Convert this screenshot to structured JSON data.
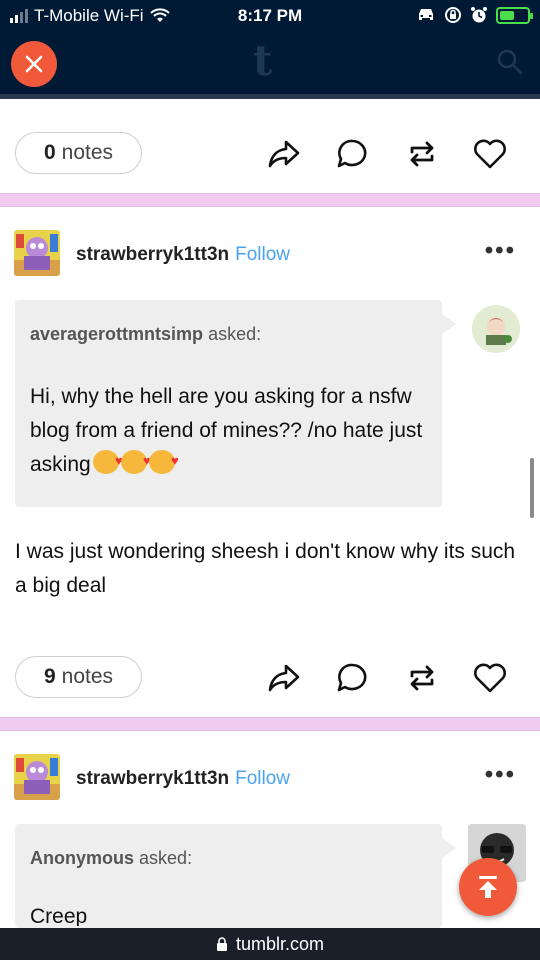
{
  "status_bar": {
    "carrier": "T-Mobile Wi-Fi",
    "time": "8:17 PM",
    "battery_percent": 45
  },
  "nav": {
    "logo": "t",
    "accent": "#f05a3a",
    "background": "#001935"
  },
  "posts": [
    {
      "notes_count": "0",
      "notes_label": "notes"
    },
    {
      "blog_name": "strawberryk1tt3n",
      "follow_label": "Follow",
      "more_label": "•••",
      "asker": "averagerottmntsimp",
      "asked_label": "asked:",
      "question": "Hi, why the hell are you asking for a nsfw blog from a friend of mines?? /no hate just asking",
      "answer": "I was just wondering sheesh i don't know why its such a big deal",
      "notes_count": "9",
      "notes_label": "notes"
    },
    {
      "blog_name": "strawberryk1tt3n",
      "follow_label": "Follow",
      "more_label": "•••",
      "asker": "Anonymous",
      "asked_label": "asked:",
      "question": "Creep"
    }
  ],
  "url_bar": {
    "url": "tumblr.com"
  },
  "icons": [
    "wifi-icon",
    "car-icon",
    "lock-rotation-icon",
    "alarm-icon",
    "battery-icon",
    "close-icon",
    "search-icon",
    "share-icon",
    "reply-icon",
    "reblog-icon",
    "like-icon",
    "more-icon",
    "scroll-to-top-icon",
    "lock-icon"
  ]
}
